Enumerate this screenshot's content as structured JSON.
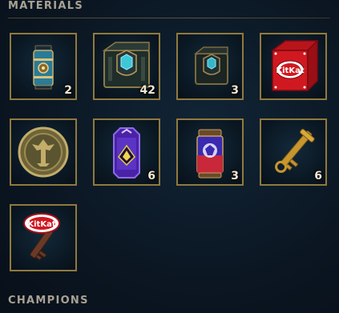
{
  "sections": {
    "materials_title": "MATERIALS",
    "champions_title": "CHAMPIONS"
  },
  "materials": [
    {
      "icon": "orb-canister-icon",
      "count": "2"
    },
    {
      "icon": "hextech-chest-icon",
      "count": "42"
    },
    {
      "icon": "masterwork-chest-icon",
      "count": "3"
    },
    {
      "icon": "kitkat-chest-icon",
      "count": ""
    },
    {
      "icon": "token-coin-icon",
      "count": ""
    },
    {
      "icon": "purple-capsule-icon",
      "count": "6"
    },
    {
      "icon": "worlds-capsule-icon",
      "count": "3"
    },
    {
      "icon": "gold-key-icon",
      "count": "6"
    },
    {
      "icon": "kitkat-key-icon",
      "count": ""
    }
  ],
  "colors": {
    "background": "#0b1622",
    "tile_border": "#8f7a3e",
    "count_text": "#f0e6d2",
    "heading_text": "#a8a293"
  }
}
